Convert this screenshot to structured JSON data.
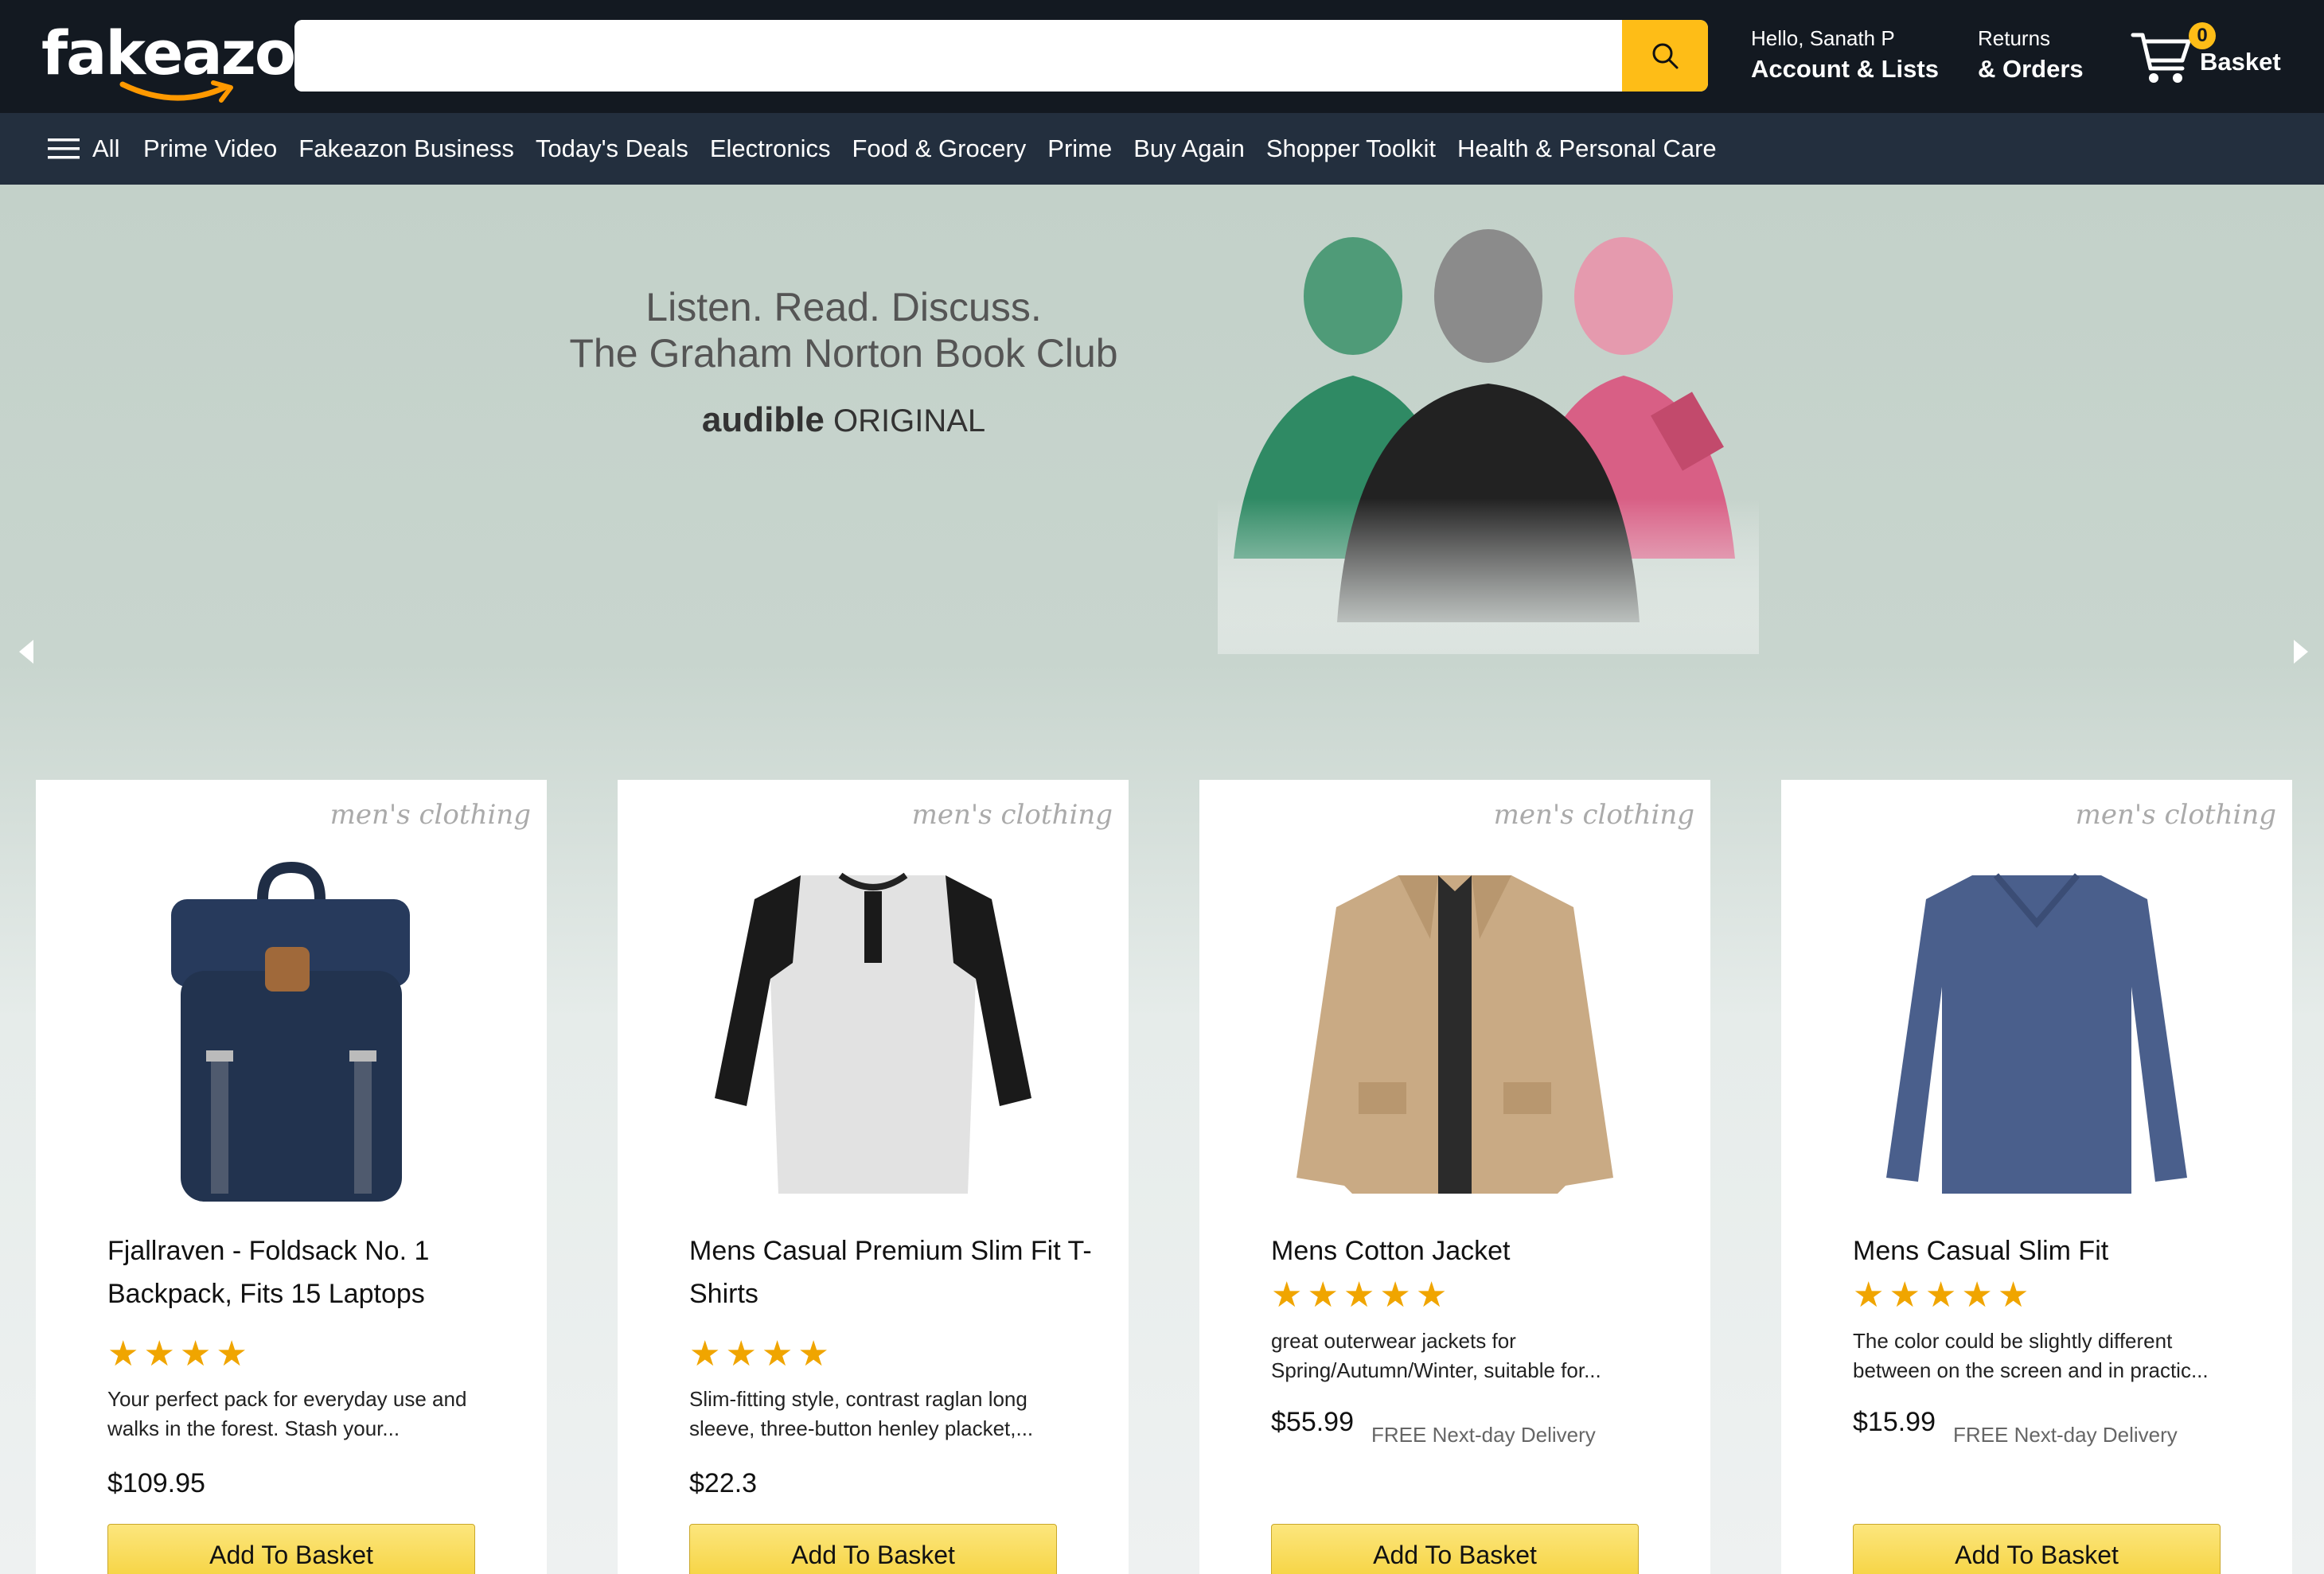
{
  "header": {
    "logo_text": "fakeazon",
    "search_placeholder": "",
    "greeting": "Hello, Sanath P",
    "account_label": "Account & Lists",
    "returns_line1": "Returns",
    "returns_line2": "& Orders",
    "basket_count": "0",
    "basket_label": "Basket"
  },
  "subnav": {
    "all_label": "All",
    "items": [
      "Prime Video",
      "Fakeazon Business",
      "Today's Deals",
      "Electronics",
      "Food & Grocery",
      "Prime",
      "Buy Again",
      "Shopper Toolkit",
      "Health & Personal Care"
    ]
  },
  "hero": {
    "line1": "Listen. Read. Discuss.",
    "line2": "The Graham Norton Book Club",
    "brand_bold": "audible",
    "brand_rest": "ORIGINAL"
  },
  "products": [
    {
      "category": "men's clothing",
      "title": "Fjallraven - Foldsack No. 1 Backpack, Fits 15 Laptops",
      "rating": 4,
      "description": "Your perfect pack for everyday use and walks in the forest. Stash your...",
      "price": "$109.95",
      "delivery": "",
      "button": "Add To Basket"
    },
    {
      "category": "men's clothing",
      "title": "Mens Casual Premium Slim Fit T-Shirts",
      "rating": 4,
      "description": "Slim-fitting style, contrast raglan long sleeve, three-button henley placket,...",
      "price": "$22.3",
      "delivery": "",
      "button": "Add To Basket"
    },
    {
      "category": "men's clothing",
      "title": "Mens Cotton Jacket",
      "rating": 5,
      "description": "great outerwear jackets for Spring/Autumn/Winter, suitable for...",
      "price": "$55.99",
      "delivery": "FREE Next-day Delivery",
      "button": "Add To Basket"
    },
    {
      "category": "men's clothing",
      "title": "Mens Casual Slim Fit",
      "rating": 5,
      "description": "The color could be slightly different between on the screen and in practic...",
      "price": "$15.99",
      "delivery": "FREE Next-day Delivery",
      "button": "Add To Basket"
    }
  ],
  "colors": {
    "header_bg": "#131921",
    "subnav_bg": "#232f3e",
    "accent": "#febd17",
    "star": "#f0a500"
  }
}
